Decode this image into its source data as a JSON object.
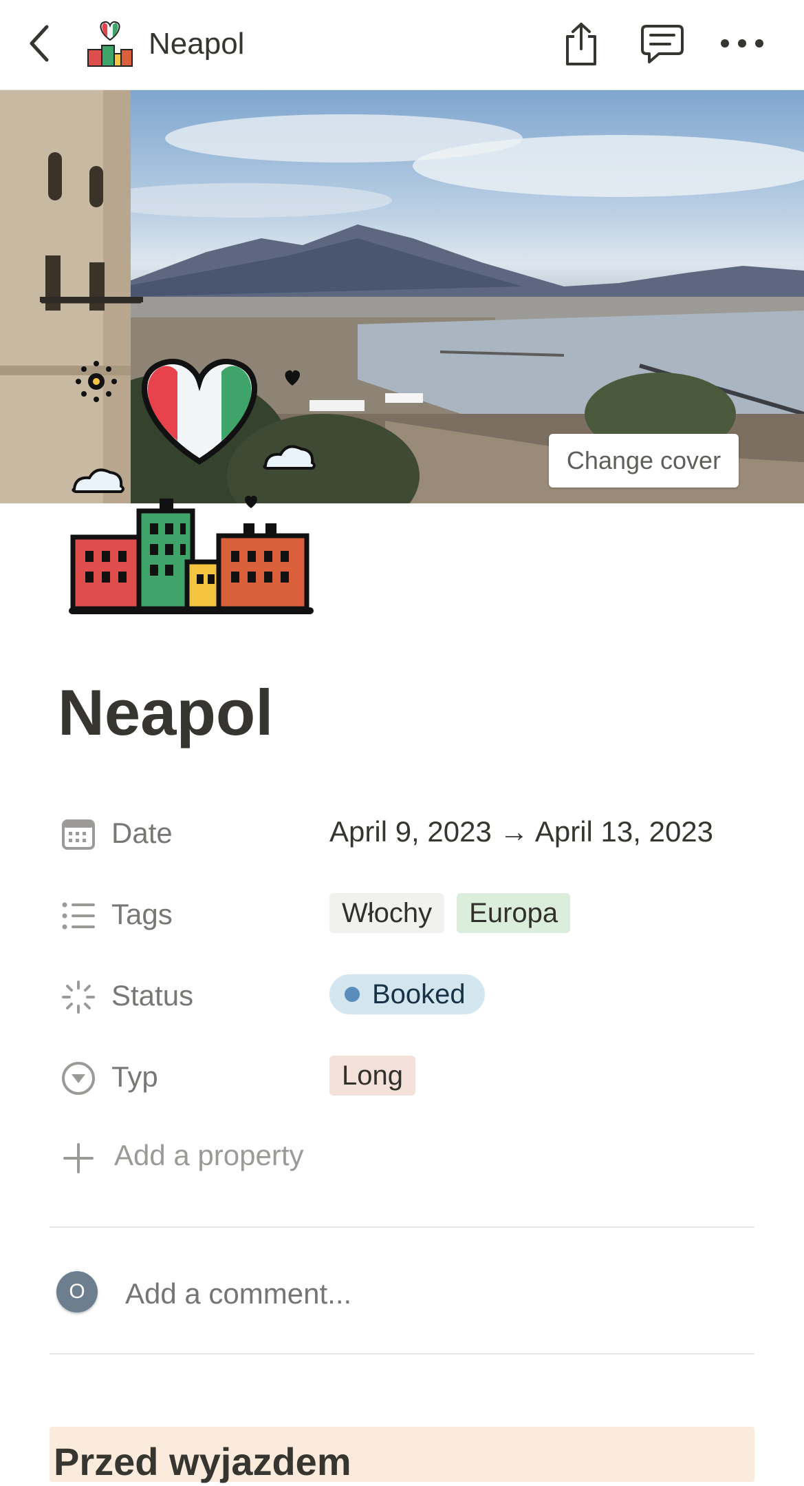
{
  "nav": {
    "title": "Neapol",
    "icons": [
      "back-chevron-icon",
      "page-emoji-icon",
      "share-icon",
      "comments-icon",
      "more-icon"
    ]
  },
  "cover": {
    "change_cover_label": "Change cover"
  },
  "page": {
    "title": "Neapol"
  },
  "properties": {
    "date": {
      "label": "Date",
      "value": "April 9, 2023 → April 13, 2023",
      "icon": "calendar-icon"
    },
    "tags": {
      "label": "Tags",
      "values": [
        "Włochy",
        "Europa"
      ],
      "icon": "list-icon"
    },
    "status": {
      "label": "Status",
      "value": "Booked",
      "icon": "status-icon"
    },
    "typ": {
      "label": "Typ",
      "value": "Long",
      "icon": "select-icon"
    },
    "add_property_label": "Add a property"
  },
  "comment": {
    "avatar_letter": "O",
    "placeholder": "Add a comment..."
  },
  "callout": {
    "title": "Przed wyjazdem"
  },
  "colors": {
    "text": "#37352f",
    "muted": "#787774",
    "tag_gray": "#f1f1ef",
    "tag_green": "#dbeddb",
    "tag_brown": "#f4e1da",
    "status_blue": "#d3e5ef",
    "callout_bg": "#faebdd"
  }
}
